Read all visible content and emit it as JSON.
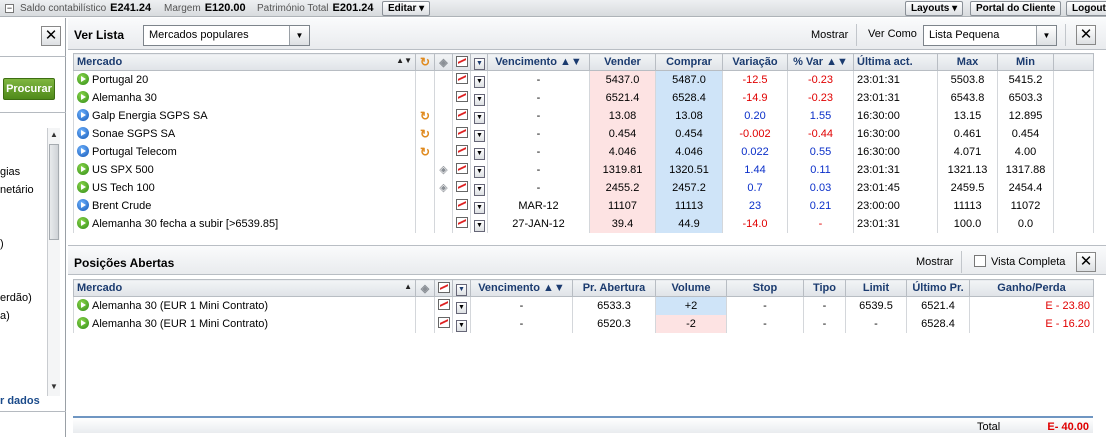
{
  "topbar": {
    "saldo_label": "Saldo contabilístico",
    "saldo_value": "E241.24",
    "margem_label": "Margem",
    "margem_value": "E120.00",
    "patrimonio_label": "Património Total",
    "patrimonio_value": "E201.24",
    "editar": "Editar",
    "layouts": "Layouts",
    "portal": "Portal do Cliente",
    "logout": "Logout"
  },
  "left": {
    "procurar": "Procurar",
    "items": [
      "gias",
      "netário",
      "",
      "erdão)",
      "a)"
    ],
    "link": "r dados"
  },
  "watchlist": {
    "title": "Ver Lista",
    "list_select": "Mercados populares",
    "mostrar": "Mostrar",
    "ver_como_label": "Ver Como",
    "ver_como_select": "Lista Pequena",
    "columns": [
      "Mercado",
      "Vencimento",
      "Vender",
      "Comprar",
      "Variação",
      "% Var",
      "Última act.",
      "Max",
      "Min"
    ],
    "rows": [
      {
        "name": "Portugal 20",
        "color": "green",
        "icon": "",
        "venc": "-",
        "sell": "5437.0",
        "buy": "5487.0",
        "var": "-12.5",
        "pvar": "-0.23",
        "time": "23:01:31",
        "max": "5503.8",
        "min": "5415.2",
        "dir": "neg"
      },
      {
        "name": "Alemanha 30",
        "color": "green",
        "icon": "",
        "venc": "-",
        "sell": "6521.4",
        "buy": "6528.4",
        "var": "-14.9",
        "pvar": "-0.23",
        "time": "23:01:31",
        "max": "6543.8",
        "min": "6503.3",
        "dir": "neg"
      },
      {
        "name": "Galp Energia SGPS SA",
        "color": "blue",
        "icon": "sync",
        "venc": "-",
        "sell": "13.08",
        "buy": "13.08",
        "var": "0.20",
        "pvar": "1.55",
        "time": "16:30:00",
        "max": "13.15",
        "min": "12.895",
        "dir": "pos"
      },
      {
        "name": "Sonae SGPS SA",
        "color": "blue",
        "icon": "sync",
        "venc": "-",
        "sell": "0.454",
        "buy": "0.454",
        "var": "-0.002",
        "pvar": "-0.44",
        "time": "16:30:00",
        "max": "0.461",
        "min": "0.454",
        "dir": "neg"
      },
      {
        "name": "Portugal Telecom",
        "color": "blue",
        "icon": "sync",
        "venc": "-",
        "sell": "4.046",
        "buy": "4.046",
        "var": "0.022",
        "pvar": "0.55",
        "time": "16:30:00",
        "max": "4.071",
        "min": "4.00",
        "dir": "pos"
      },
      {
        "name": "US SPX 500",
        "color": "green",
        "icon": "tag",
        "venc": "-",
        "sell": "1319.81",
        "buy": "1320.51",
        "var": "1.44",
        "pvar": "0.11",
        "time": "23:01:31",
        "max": "1321.13",
        "min": "1317.88",
        "dir": "pos"
      },
      {
        "name": "US Tech 100",
        "color": "green",
        "icon": "tag",
        "venc": "-",
        "sell": "2455.2",
        "buy": "2457.2",
        "var": "0.7",
        "pvar": "0.03",
        "time": "23:01:45",
        "max": "2459.5",
        "min": "2454.4",
        "dir": "pos"
      },
      {
        "name": "Brent Crude",
        "color": "blue",
        "icon": "",
        "venc": "MAR-12",
        "sell": "11107",
        "buy": "11113",
        "var": "23",
        "pvar": "0.21",
        "time": "23:00:00",
        "max": "11113",
        "min": "11072",
        "dir": "pos"
      },
      {
        "name": "Alemanha 30 fecha a subir [>6539.85]",
        "color": "green",
        "icon": "",
        "venc": "27-JAN-12",
        "sell": "39.4",
        "buy": "44.9",
        "var": "-14.0",
        "pvar": "-",
        "time": "23:01:31",
        "max": "100.0",
        "min": "0.0",
        "dir": "neg"
      }
    ]
  },
  "positions": {
    "title": "Posições Abertas",
    "mostrar": "Mostrar",
    "vista_completa": "Vista Completa",
    "columns": [
      "Mercado",
      "Vencimento",
      "Pr. Abertura",
      "Volume",
      "Stop",
      "Tipo",
      "Limit",
      "Último Pr.",
      "Ganho/Perda"
    ],
    "rows": [
      {
        "name": "Alemanha 30 (EUR 1 Mini Contrato)",
        "venc": "-",
        "open": "6533.3",
        "vol": "+2",
        "vol_dir": "buy",
        "stop": "-",
        "tipo": "-",
        "limit": "6539.5",
        "last": "6521.4",
        "pl": "E - 23.80"
      },
      {
        "name": "Alemanha 30 (EUR 1 Mini Contrato)",
        "venc": "-",
        "open": "6520.3",
        "vol": "-2",
        "vol_dir": "sell",
        "stop": "-",
        "tipo": "-",
        "limit": "-",
        "last": "6528.4",
        "pl": "E - 16.20"
      }
    ],
    "total_label": "Total",
    "total_value": "E- 40.00"
  },
  "colors": {
    "sell_bg": "#fde3e3",
    "buy_bg": "#cfe4f8",
    "negative": "#e00000",
    "positive": "#0a2fc9",
    "procurar": "#5e9a22"
  }
}
